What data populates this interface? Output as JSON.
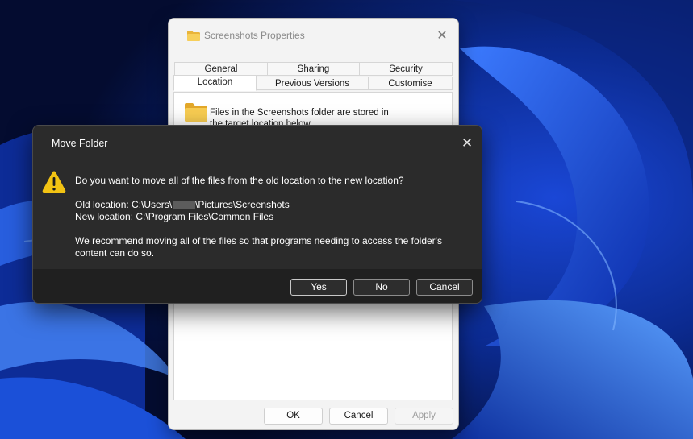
{
  "properties_window": {
    "title": "Screenshots Properties",
    "tabs_row1": [
      "General",
      "Sharing",
      "Security"
    ],
    "tabs_row2": [
      "Location",
      "Previous Versions",
      "Customise"
    ],
    "active_tab": "Location",
    "location_description": "Files in the Screenshots folder are stored in the target location below.",
    "buttons": {
      "ok": "OK",
      "cancel": "Cancel",
      "apply": "Apply"
    }
  },
  "move_folder_dialog": {
    "title": "Move Folder",
    "question": "Do you want to move all of the files from the old location to the new location?",
    "old_location_prefix": "Old location: C:\\Users\\",
    "old_location_suffix": "\\Pictures\\Screenshots",
    "new_location": "New location: C:\\Program Files\\Common Files",
    "recommendation_line1": "We recommend moving all of the files so that programs needing to access the folder's",
    "recommendation_line2": "content can do so.",
    "buttons": {
      "yes": "Yes",
      "no": "No",
      "cancel": "Cancel"
    }
  },
  "icons": [
    "folder-icon",
    "close-icon",
    "warning-icon"
  ],
  "colors": {
    "dialog_bg": "#2b2b2b",
    "dialog_footer": "#202020",
    "warning_yellow": "#f2c313",
    "wallpaper_accent": "#1f5cff"
  }
}
